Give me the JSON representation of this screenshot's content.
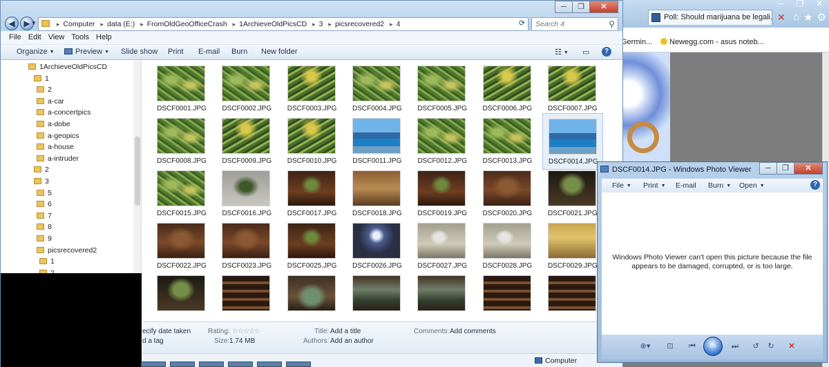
{
  "browser": {
    "tab_title": "Poll: Should marijuana be legali...",
    "favorites": [
      "is Germin...",
      "Newegg.com - asus noteb..."
    ]
  },
  "explorer": {
    "breadcrumb": [
      "Computer",
      "data (E:)",
      "FromOldGeoOfficeCrash",
      "1ArchieveOldPicsCD",
      "3",
      "picsrecovered2",
      "4"
    ],
    "search_placeholder": "Search 4",
    "menu": [
      "File",
      "Edit",
      "View",
      "Tools",
      "Help"
    ],
    "toolbar": {
      "organize": "Organize",
      "preview": "Preview",
      "slideshow": "Slide show",
      "print": "Print",
      "email": "E-mail",
      "burn": "Burn",
      "newfolder": "New folder"
    },
    "tree": [
      {
        "label": "1ArchieveOldPicsCD",
        "level": 0
      },
      {
        "label": "1",
        "level": 1
      },
      {
        "label": "2",
        "level": 2
      },
      {
        "label": "a-car",
        "level": 2
      },
      {
        "label": "a-concertpics",
        "level": 2
      },
      {
        "label": "a-dobe",
        "level": 2
      },
      {
        "label": "a-geopics",
        "level": 2
      },
      {
        "label": "a-house",
        "level": 2
      },
      {
        "label": "a-intruder",
        "level": 2
      },
      {
        "label": "2",
        "level": 1
      },
      {
        "label": "3",
        "level": 1
      },
      {
        "label": "5",
        "level": 2
      },
      {
        "label": "6",
        "level": 2
      },
      {
        "label": "7",
        "level": 2
      },
      {
        "label": "8",
        "level": 2
      },
      {
        "label": "9",
        "level": 2
      },
      {
        "label": "picsrecovered2",
        "level": 2
      },
      {
        "label": "1",
        "level": 3
      },
      {
        "label": "2",
        "level": 3
      }
    ],
    "files": [
      {
        "name": "DSCF0001.JPG",
        "kind": "plant"
      },
      {
        "name": "DSCF0002.JPG",
        "kind": "plant"
      },
      {
        "name": "DSCF0003.JPG",
        "kind": "plantyel"
      },
      {
        "name": "DSCF0004.JPG",
        "kind": "plant"
      },
      {
        "name": "DSCF0005.JPG",
        "kind": "plant"
      },
      {
        "name": "DSCF0006.JPG",
        "kind": "plantyel"
      },
      {
        "name": "DSCF0007.JPG",
        "kind": "plantyel"
      },
      {
        "name": "DSCF0008.JPG",
        "kind": "plant"
      },
      {
        "name": "DSCF0009.JPG",
        "kind": "plantyel"
      },
      {
        "name": "DSCF0010.JPG",
        "kind": "plantyel"
      },
      {
        "name": "DSCF0011.JPG",
        "kind": "sky"
      },
      {
        "name": "DSCF0012.JPG",
        "kind": "plant"
      },
      {
        "name": "DSCF0013.JPG",
        "kind": "plant"
      },
      {
        "name": "DSCF0014.JPG",
        "kind": "sky",
        "selected": true
      },
      {
        "name": "DSCF0015.JPG",
        "kind": "plant"
      },
      {
        "name": "DSCF0016.JPG",
        "kind": "gray"
      },
      {
        "name": "DSCF0017.JPG",
        "kind": "roompl"
      },
      {
        "name": "DSCF0018.JPG",
        "kind": "potrow"
      },
      {
        "name": "DSCF0019.JPG",
        "kind": "roompl"
      },
      {
        "name": "DSCF0020.JPG",
        "kind": "room"
      },
      {
        "name": "DSCF0021.JPG",
        "kind": "plantblk"
      },
      {
        "name": "DSCF0022.JPG",
        "kind": "room"
      },
      {
        "name": "DSCF0023.JPG",
        "kind": "room"
      },
      {
        "name": "DSCF0025.JPG",
        "kind": "roompl"
      },
      {
        "name": "DSCF0026.JPG",
        "kind": "light"
      },
      {
        "name": "DSCF0027.JPG",
        "kind": "pc"
      },
      {
        "name": "DSCF0028.JPG",
        "kind": "pc"
      },
      {
        "name": "DSCF0029.JPG",
        "kind": "sign"
      },
      {
        "name": "",
        "kind": "plantblk"
      },
      {
        "name": "",
        "kind": "shelf"
      },
      {
        "name": "",
        "kind": "aq"
      },
      {
        "name": "",
        "kind": "aq2"
      },
      {
        "name": "",
        "kind": "aq2"
      },
      {
        "name": "",
        "kind": "shelf"
      },
      {
        "name": "",
        "kind": "shelf"
      }
    ],
    "details": {
      "date_taken": "ecify date taken",
      "tags": "d a tag",
      "rating_label": "Rating:",
      "size_label": "Size:",
      "size_value": "1.74 MB",
      "title_label": "Title:",
      "title_value": "Add a title",
      "authors_label": "Authors:",
      "authors_value": "Add an author",
      "comments_label": "Comments:",
      "comments_value": "Add comments"
    },
    "status": "Computer"
  },
  "viewer": {
    "title": "DSCF0014.JPG - Windows Photo Viewer",
    "menu": [
      "File",
      "Print",
      "E-mail",
      "Burn",
      "Open"
    ],
    "message": "Windows Photo Viewer can't open this picture because the file appears to be damaged, corrupted, or is too large."
  },
  "colors": {
    "accent": "#2e67b1",
    "selection": "#e6f0fb",
    "window_frame": "#b7d0ea"
  },
  "icons": [
    "back-icon",
    "forward-icon",
    "folder-icon",
    "search-icon",
    "help-icon",
    "close-icon",
    "home-icon",
    "star-icon",
    "gear-icon",
    "rotate-left-icon",
    "rotate-right-icon",
    "delete-icon"
  ]
}
